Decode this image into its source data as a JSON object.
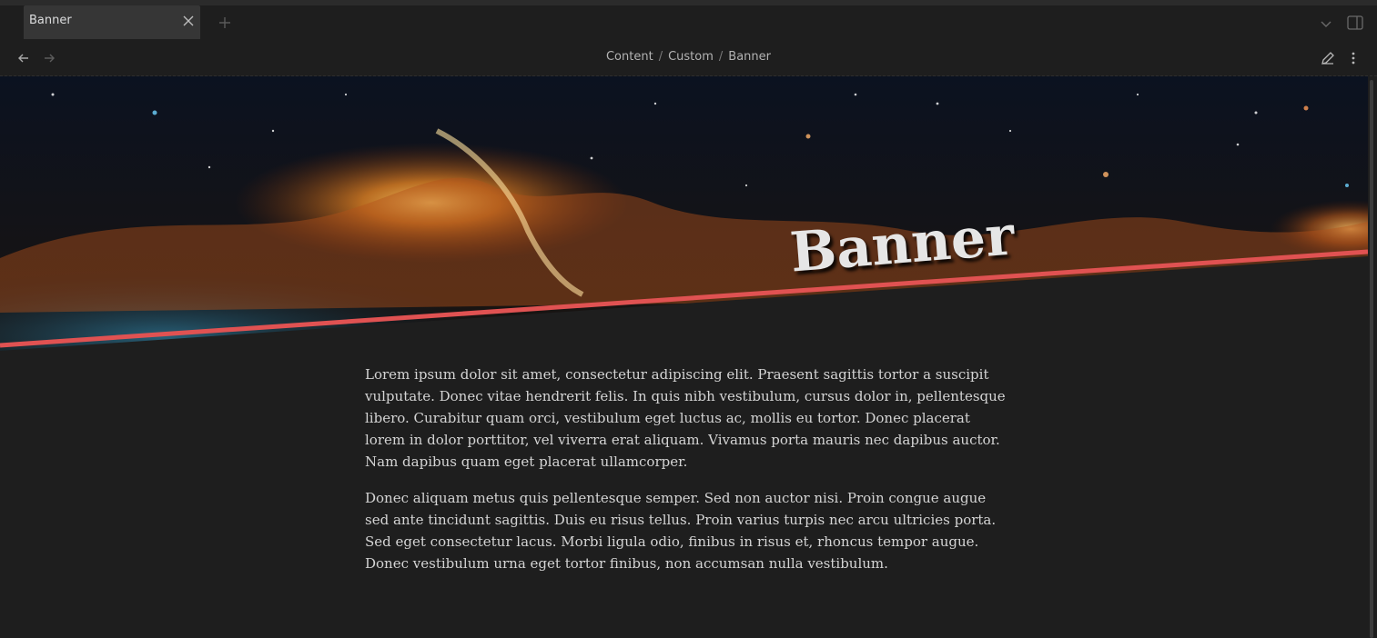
{
  "tabs": [
    {
      "label": "Banner",
      "active": true
    }
  ],
  "breadcrumb": [
    "Content",
    "Custom",
    "Banner"
  ],
  "banner": {
    "title": "Banner",
    "accent_color": "#e05252"
  },
  "content": {
    "paragraphs": [
      "Lorem ipsum dolor sit amet, consectetur adipiscing elit. Praesent sagittis tortor a suscipit vulputate. Donec vitae hendrerit felis. In quis nibh vestibulum, cursus dolor in, pellentesque libero. Curabitur quam orci, vestibulum eget luctus ac, mollis eu tortor. Donec placerat lorem in dolor porttitor, vel viverra erat aliquam. Vivamus porta mauris nec dapibus auctor. Nam dapibus quam eget placerat ullamcorper.",
      "Donec aliquam metus quis pellentesque semper. Sed non auctor nisi. Proin congue augue sed ante tincidunt sagittis. Duis eu risus tellus. Proin varius turpis nec arcu ultricies porta. Sed eget consectetur lacus. Morbi ligula odio, finibus in risus et, rhoncus tempor augue. Donec vestibulum urna eget tortor finibus, non accumsan nulla vestibulum."
    ]
  },
  "icons": {
    "close": "close-icon",
    "new_tab": "plus-icon",
    "tab_list": "chevron-down-icon",
    "sidebar": "sidebar-toggle-icon",
    "back": "arrow-left-icon",
    "forward": "arrow-right-icon",
    "edit": "pencil-icon",
    "more": "more-vertical-icon"
  }
}
